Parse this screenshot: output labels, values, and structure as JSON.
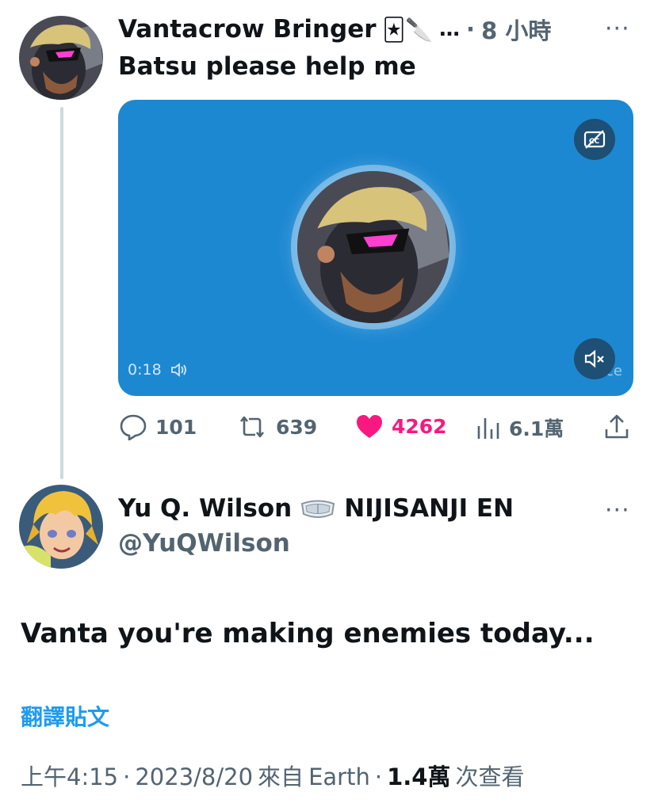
{
  "tweet1": {
    "author_name": "Vantacrow Bringer",
    "emoji_badges": "🃏🔪",
    "ellipsis": "…",
    "separator": "·",
    "time": "8 小時",
    "more": "···",
    "text": "Batsu please help me",
    "media": {
      "duration": "0:18",
      "watermark": "Voice",
      "cc_icon": "captions-off-icon",
      "mute_icon": "muted-speaker-icon",
      "bg_color": "#1d88d2"
    },
    "actions": {
      "replies": "101",
      "retweets": "639",
      "likes": "4262",
      "views": "6.1萬"
    }
  },
  "tweet2": {
    "author_name": "Yu Q. Wilson",
    "badge_icon": "goggles-icon",
    "org": "NIJISANJI EN",
    "handle": "@YuQWilson",
    "more": "···",
    "text": "Vanta you're making enemies today...",
    "translate": "翻譯貼文",
    "time": "上午4:15",
    "sep1": "·",
    "date": "2023/8/20",
    "source_prefix": "來自",
    "source": "Earth",
    "sep2": "·",
    "views_count": "1.4萬",
    "views_label": "次查看"
  },
  "colors": {
    "like": "#f91880",
    "link": "#1d9bf0",
    "muted": "#536471",
    "text": "#0f1419"
  }
}
